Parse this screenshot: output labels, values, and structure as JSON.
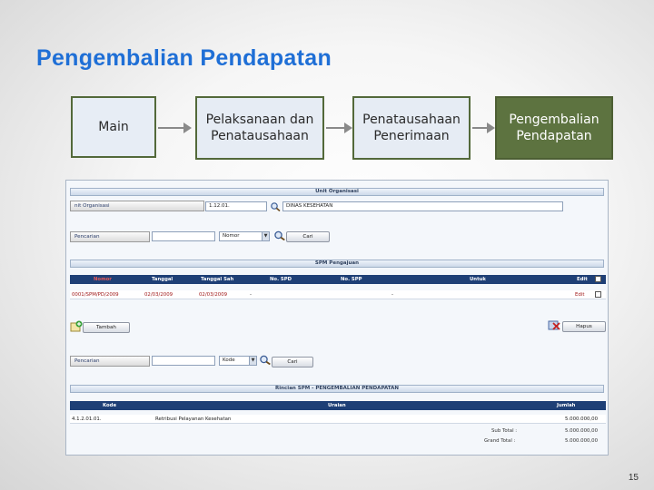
{
  "slide": {
    "title": "Pengembalian Pendapatan",
    "page_number": "15"
  },
  "flow": [
    {
      "label": "Main"
    },
    {
      "label": "Pelaksanaan dan Penatausahaan"
    },
    {
      "label": "Penatausahaan Penerimaan"
    },
    {
      "label": "Pengembalian Pendapatan"
    }
  ],
  "colors": {
    "title": "#1f6fd6",
    "flow_box_border": "#53693a",
    "flow_box_active": "#5d7340",
    "table_header": "#1e3f76",
    "row_text_red": "#a01818"
  },
  "app": {
    "unit_bar": "Unit Organisasi",
    "unit_label": "nit Organisasi",
    "unit_code": "1.12.01.",
    "unit_name": "DINAS KESEHATAN",
    "search1": {
      "label": "Pencarian",
      "value": "",
      "select": "Nomor",
      "button": "Cari"
    },
    "spm_bar": "SPM Pengajuan",
    "spm_table": {
      "headers": [
        "Nomor",
        "Tanggal",
        "Tanggal Sah",
        "No. SPD",
        "No. SPP",
        "Untuk",
        "Edit"
      ],
      "rows": [
        {
          "nomor": "0001/SPM/PD/2009",
          "tanggal": "02/03/2009",
          "tanggal_sah": "02/03/2009",
          "no_spd": "-",
          "no_spp": "-",
          "untuk": "",
          "edit": "Edit"
        }
      ]
    },
    "add_button": "Tambah",
    "delete_button": "Hapus",
    "search2": {
      "label": "Pencarian",
      "value": "",
      "select": "Kode",
      "button": "Cari"
    },
    "detail_bar": "Rincian SPM - PENGEMBALIAN PENDAPATAN",
    "detail_table": {
      "headers": [
        "Kode",
        "Uraian",
        "Jumlah"
      ],
      "rows": [
        {
          "kode": "4.1.2.01.01.",
          "uraian": "Retribusi Pelayanan Kesehatan",
          "jumlah": "5.000.000,00"
        }
      ]
    },
    "sub_total_label": "Sub Total :",
    "sub_total_value": "5.000.000,00",
    "grand_total_label": "Grand Total :",
    "grand_total_value": "5.000.000,00"
  }
}
